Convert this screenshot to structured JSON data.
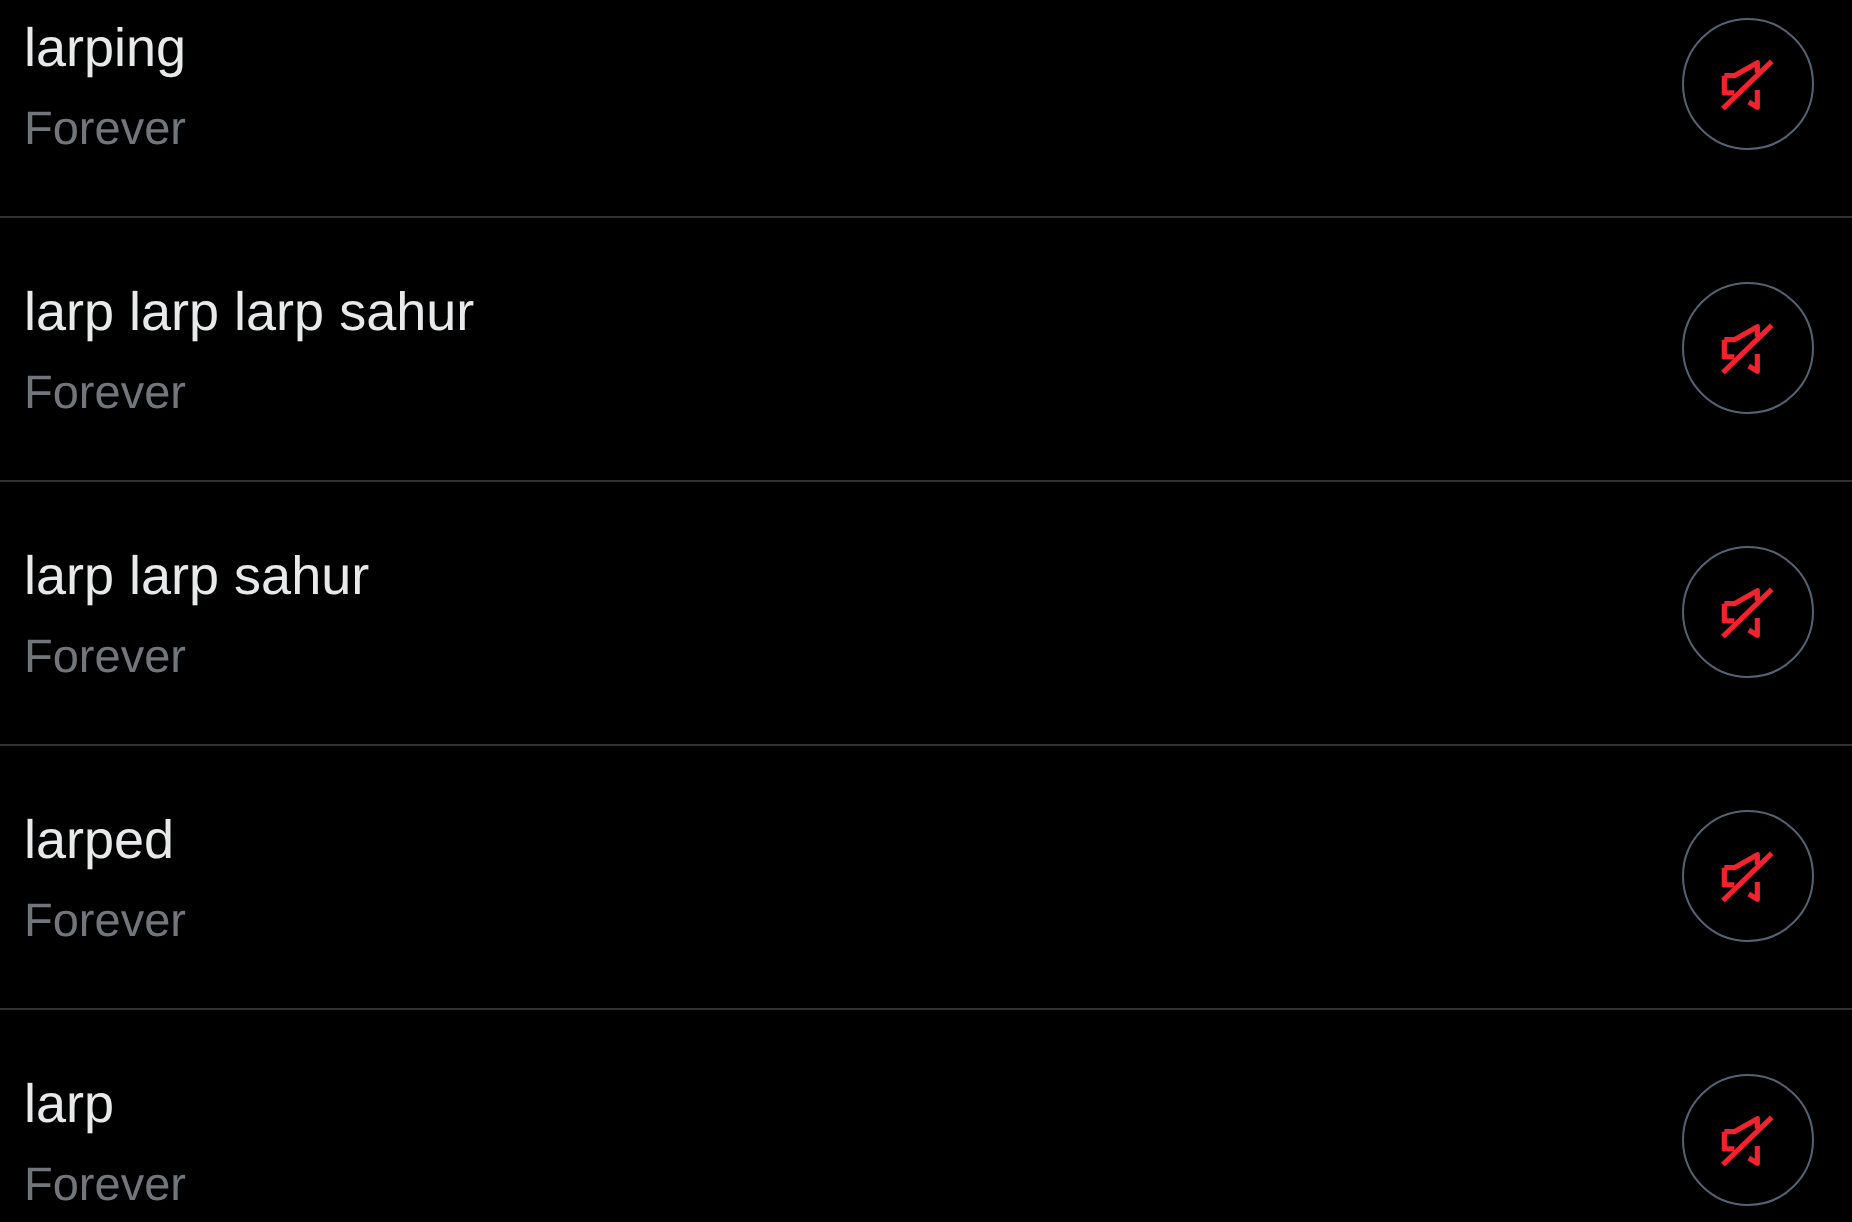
{
  "muted_words": [
    {
      "word": "larping",
      "duration": "Forever",
      "muted": true
    },
    {
      "word": "larp larp larp sahur",
      "duration": "Forever",
      "muted": true
    },
    {
      "word": "larp larp sahur",
      "duration": "Forever",
      "muted": true
    },
    {
      "word": "larped",
      "duration": "Forever",
      "muted": true
    },
    {
      "word": "larp",
      "duration": "Forever",
      "muted": true
    }
  ]
}
